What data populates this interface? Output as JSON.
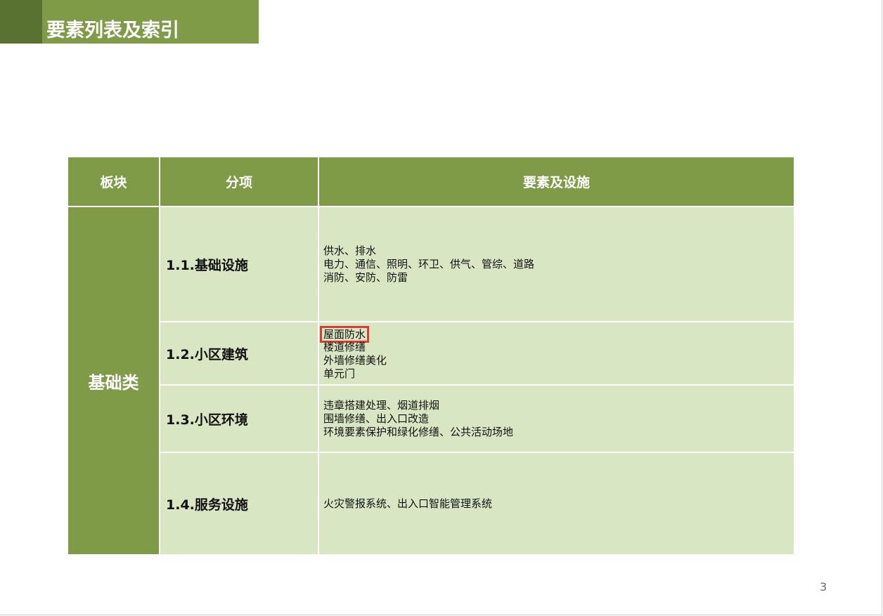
{
  "slide": {
    "title": "要素列表及索引",
    "page_number": "3"
  },
  "table": {
    "headers": [
      "板块",
      "分项",
      "要素及设施"
    ],
    "block": "基础类",
    "rows": [
      {
        "sub": "1.1.基础设施",
        "items": [
          "供水、排水",
          "电力、通信、照明、环卫、供气、管综、道路",
          "消防、安防、防雷"
        ]
      },
      {
        "sub": "1.2.小区建筑",
        "items": [
          "屋面防水",
          "楼道修缮",
          "外墙修缮美化",
          "单元门"
        ]
      },
      {
        "sub": "1.3.小区环境",
        "items": [
          "违章搭建处理、烟道排烟",
          "围墙修缮、出入口改造",
          "环境要素保护和绿化修缮、公共活动场地"
        ]
      },
      {
        "sub": "1.4.服务设施",
        "items": [
          "火灾警报系统、出入口智能管理系统"
        ]
      }
    ],
    "highlight_color": "#e03a35",
    "header_color": "#7f9b48",
    "cell_color": "#d9e6c4"
  }
}
